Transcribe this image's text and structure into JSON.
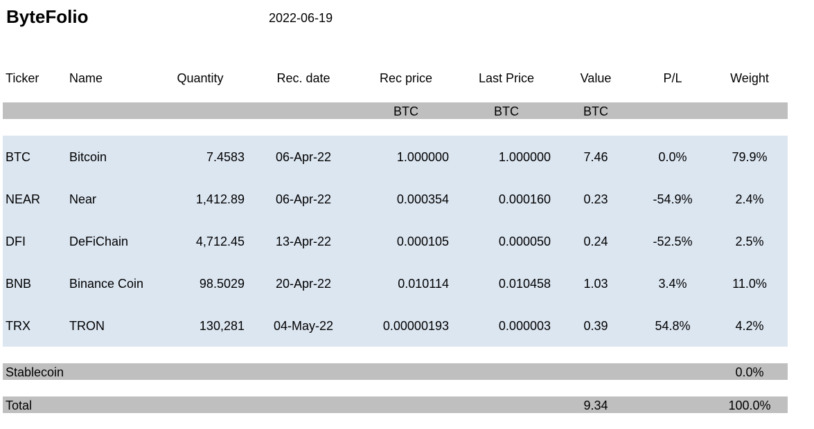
{
  "header": {
    "title": "ByteFolio",
    "date": "2022-06-19"
  },
  "columns": [
    "Ticker",
    "Name",
    "Quantity",
    "Rec. date",
    "Rec price",
    "Last Price",
    "Value",
    "P/L",
    "Weight"
  ],
  "units": {
    "rec_price": "BTC",
    "last_price": "BTC",
    "value": "BTC"
  },
  "rows": [
    [
      "BTC",
      "Bitcoin",
      "7.4583",
      "06-Apr-22",
      "1.000000",
      "1.000000",
      "7.46",
      "0.0%",
      "79.9%"
    ],
    [
      "NEAR",
      "Near",
      "1,412.89",
      "06-Apr-22",
      "0.000354",
      "0.000160",
      "0.23",
      "-54.9%",
      "2.4%"
    ],
    [
      "DFI",
      "DeFiChain",
      "4,712.45",
      "13-Apr-22",
      "0.000105",
      "0.000050",
      "0.24",
      "-52.5%",
      "2.5%"
    ],
    [
      "BNB",
      "Binance Coin",
      "98.5029",
      "20-Apr-22",
      "0.010114",
      "0.010458",
      "1.03",
      "3.4%",
      "11.0%"
    ],
    [
      "TRX",
      "TRON",
      "130,281",
      "04-May-22",
      "0.00000193",
      "0.000003",
      "0.39",
      "54.8%",
      "4.2%"
    ]
  ],
  "stablecoin": {
    "label": "Stablecoin",
    "weight": "0.0%"
  },
  "total": {
    "label": "Total",
    "value": "9.34",
    "weight": "100.0%"
  }
}
